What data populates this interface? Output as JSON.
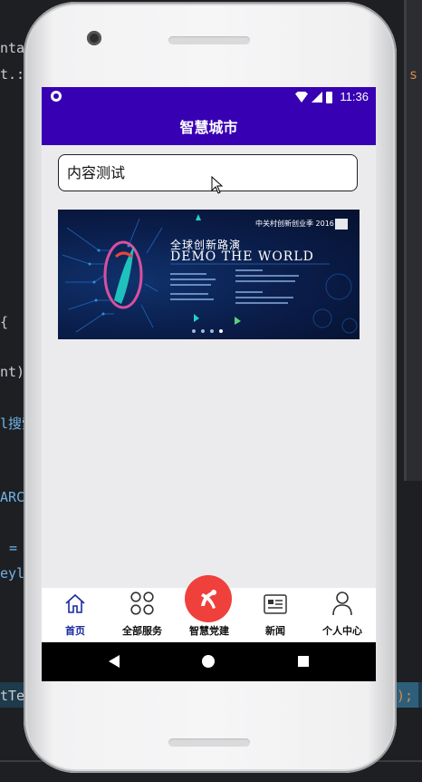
{
  "editor": {
    "lines": [
      {
        "text": "nta",
        "style": "plain"
      },
      {
        "text": "t.:",
        "style": "plain"
      },
      {
        "text": "{",
        "style": "plain"
      },
      {
        "text": "nt)",
        "style": "plain"
      },
      {
        "text": "l搜索",
        "style": "plain"
      },
      {
        "text": "ARC",
        "style": "blue"
      },
      {
        "text": "=",
        "style": "blue"
      },
      {
        "text": "eyl",
        "style": "blue"
      },
      {
        "text": "tTe",
        "style": "plain"
      },
      {
        "text": ");",
        "style": "orange"
      },
      {
        "text": "s",
        "style": "orange"
      }
    ]
  },
  "statusbar": {
    "time": "11:36"
  },
  "appbar": {
    "title": "智慧城市"
  },
  "search": {
    "value": "内容测试"
  },
  "banner": {
    "top_text": "中关村创新创业季 2016",
    "headline": "全球创新路演",
    "subheadline": "DEMO THE WORLD",
    "dot_count": 4,
    "active_dot": 3
  },
  "bottom_nav": {
    "items": [
      {
        "label": "首页",
        "icon": "home-icon",
        "active": true
      },
      {
        "label": "全部服务",
        "icon": "grid-icon",
        "active": false
      },
      {
        "label": "智慧党建",
        "icon": "party-emblem-icon",
        "active": false
      },
      {
        "label": "新闻",
        "icon": "news-icon",
        "active": false
      },
      {
        "label": "个人中心",
        "icon": "person-icon",
        "active": false
      }
    ]
  },
  "colors": {
    "primary": "#3700b3",
    "nav_active": "#1a2a9e",
    "party_red": "#f0403c"
  }
}
